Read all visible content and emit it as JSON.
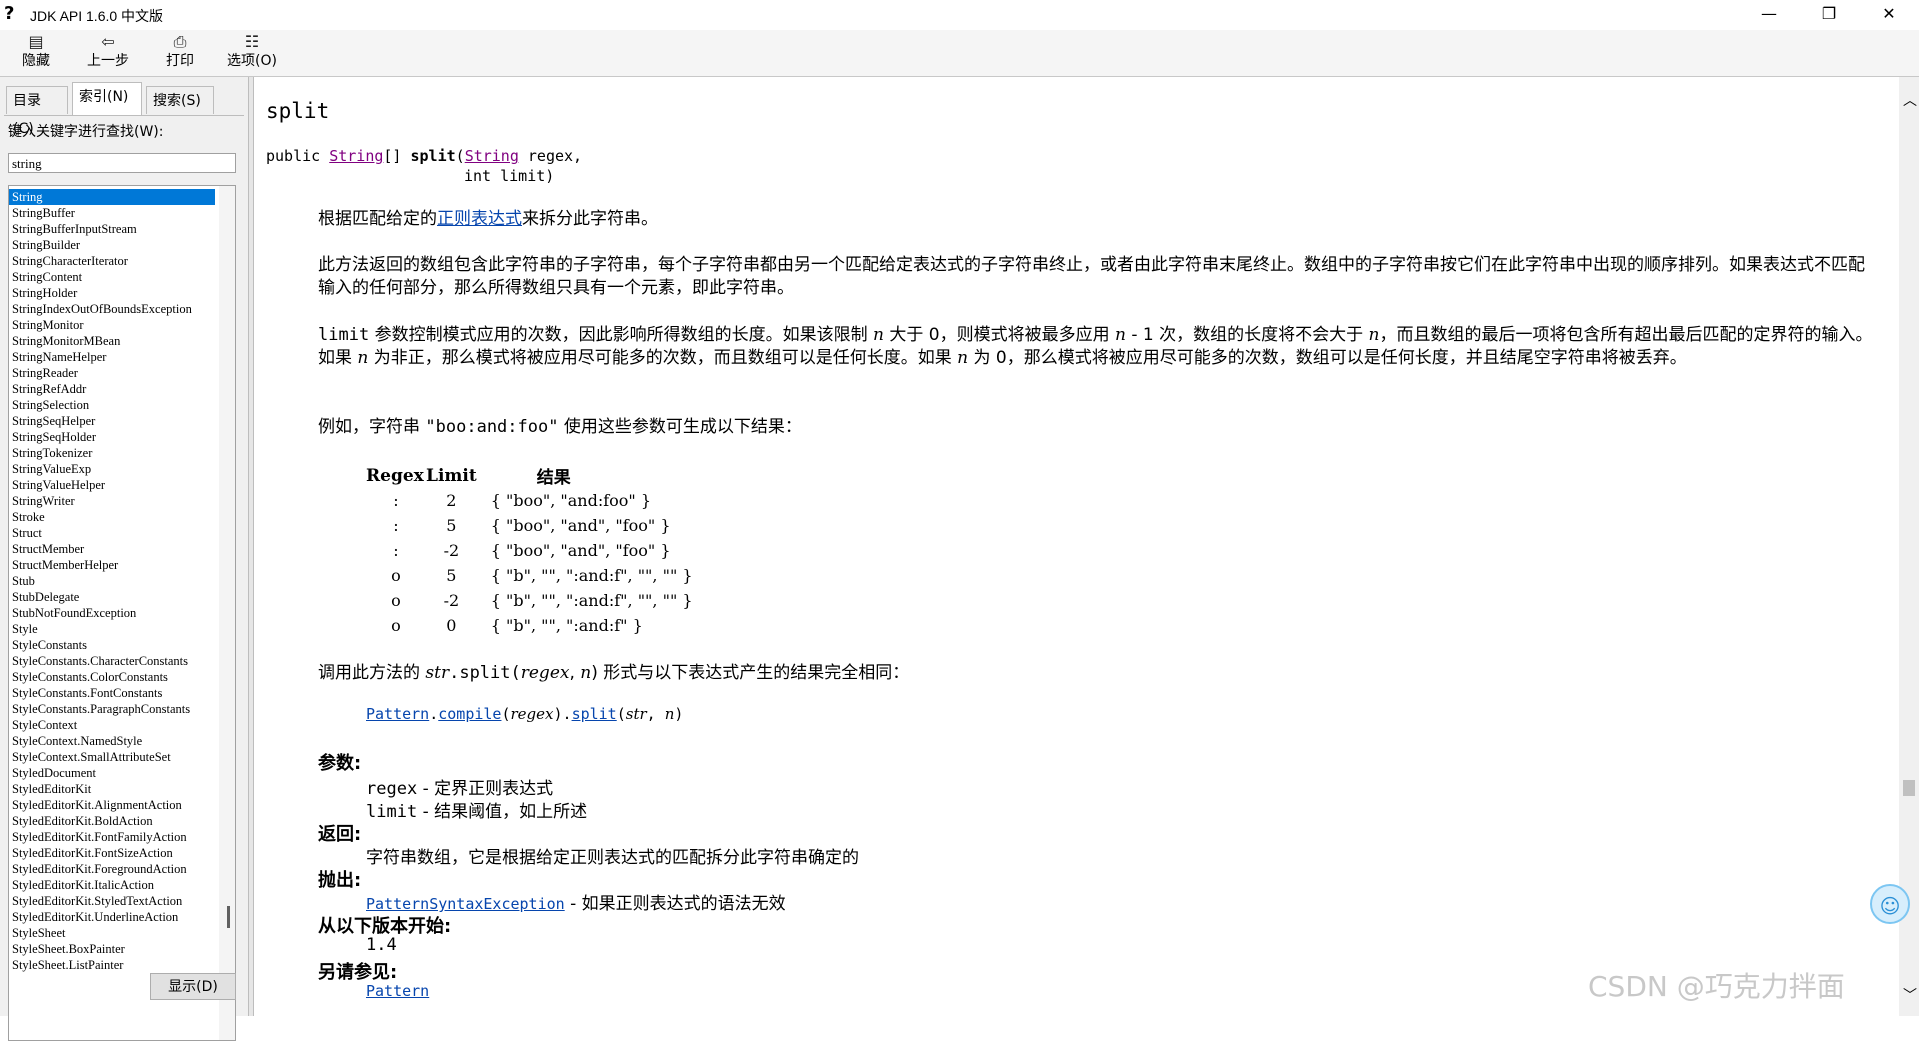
{
  "window": {
    "title": "JDK API 1.6.0 中文版",
    "icon": "help-question-icon",
    "controls": {
      "minimize": "—",
      "maximize": "❐",
      "close": "✕"
    }
  },
  "toolbar": {
    "hide": {
      "icon": "hide-pane-icon",
      "glyph": "▤",
      "label": "隐藏"
    },
    "back": {
      "icon": "back-arrow-icon",
      "glyph": "⇦",
      "label": "上一步"
    },
    "print": {
      "icon": "printer-icon",
      "glyph": "⎙",
      "label": "打印"
    },
    "options": {
      "icon": "options-icon",
      "glyph": "☷",
      "label": "选项(O)"
    }
  },
  "leftpanel": {
    "tabs": {
      "contents": "目录(C)",
      "index": "索引(N)",
      "search": "搜索(S)"
    },
    "keyword_label": "键入关键字进行查找(W):",
    "keyword_value": "string",
    "items": [
      "String",
      "StringBuffer",
      "StringBufferInputStream",
      "StringBuilder",
      "StringCharacterIterator",
      "StringContent",
      "StringHolder",
      "StringIndexOutOfBoundsException",
      "StringMonitor",
      "StringMonitorMBean",
      "StringNameHelper",
      "StringReader",
      "StringRefAddr",
      "StringSelection",
      "StringSeqHelper",
      "StringSeqHolder",
      "StringTokenizer",
      "StringValueExp",
      "StringValueHelper",
      "StringWriter",
      "Stroke",
      "Struct",
      "StructMember",
      "StructMemberHelper",
      "Stub",
      "StubDelegate",
      "StubNotFoundException",
      "Style",
      "StyleConstants",
      "StyleConstants.CharacterConstants",
      "StyleConstants.ColorConstants",
      "StyleConstants.FontConstants",
      "StyleConstants.ParagraphConstants",
      "StyleContext",
      "StyleContext.NamedStyle",
      "StyleContext.SmallAttributeSet",
      "StyledDocument",
      "StyledEditorKit",
      "StyledEditorKit.AlignmentAction",
      "StyledEditorKit.BoldAction",
      "StyledEditorKit.FontFamilyAction",
      "StyledEditorKit.FontSizeAction",
      "StyledEditorKit.ForegroundAction",
      "StyledEditorKit.ItalicAction",
      "StyledEditorKit.StyledTextAction",
      "StyledEditorKit.UnderlineAction",
      "StyleSheet",
      "StyleSheet.BoxPainter",
      "StyleSheet.ListPainter"
    ],
    "selected_index": 0,
    "display_button": "显示(D)"
  },
  "content": {
    "method_name": "split",
    "sig": {
      "public": "public ",
      "string_type": "String",
      "arr": "[] ",
      "name": "split",
      "open": "(",
      "param_type": "String",
      "param1": " regex,",
      "param2": "int limit)"
    },
    "p1": {
      "pre": "根据匹配给定的",
      "link": "正则表达式",
      "post": "来拆分此字符串。"
    },
    "p2": "此方法返回的数组包含此字符串的子字符串，每个子字符串都由另一个匹配给定表达式的子字符串终止，或者由此字符串末尾终止。数组中的子字符串按它们在此字符串中出现的顺序排列。如果表达式不匹配输入的任何部分，那么所得数组只具有一个元素，即此字符串。",
    "p3": {
      "code": "limit",
      "a": " 参数控制模式应用的次数，因此影响所得数组的长度。如果该限制 ",
      "n1": "n",
      "b": " 大于 0，则模式将被最多应用 ",
      "n2": "n",
      "c": " - 1 次，数组的长度将不会大于 ",
      "n3": "n",
      "d": "，而且数组的最后一项将包含所有超出最后匹配的定界符的输入。如果 ",
      "n4": "n",
      "e": " 为非正，那么模式将被应用尽可能多的次数，而且数组可以是任何长度。如果 ",
      "n5": "n",
      "f": " 为 0，那么模式将被应用尽可能多的次数，数组可以是任何长度，并且结尾空字符串将被丢弃。"
    },
    "p4": {
      "pre": "例如，字符串 ",
      "code": "\"boo:and:foo\"",
      "post": " 使用这些参数可生成以下结果："
    },
    "table": {
      "headers": [
        "Regex",
        "Limit",
        "结果"
      ],
      "rows": [
        [
          ":",
          "2",
          "{ \"boo\", \"and:foo\" }"
        ],
        [
          ":",
          "5",
          "{ \"boo\", \"and\", \"foo\" }"
        ],
        [
          ":",
          "-2",
          "{ \"boo\", \"and\", \"foo\" }"
        ],
        [
          "o",
          "5",
          "{ \"b\", \"\", \":and:f\", \"\", \"\" }"
        ],
        [
          "o",
          "-2",
          "{ \"b\", \"\", \":and:f\", \"\", \"\" }"
        ],
        [
          "o",
          "0",
          "{ \"b\", \"\", \":and:f\" }"
        ]
      ]
    },
    "p5": {
      "pre": "调用此方法的 ",
      "str": "str",
      "mid": ".split(",
      "regex": "regex",
      "comma": ", ",
      "n": "n",
      "post": ") 形式与以下表达式产生的结果完全相同："
    },
    "code": {
      "pattern": "Pattern",
      "dot1": ".",
      "compile": "compile",
      "open": "(",
      "regex": "regex",
      "close_dot": ").",
      "split": "split",
      "open2": "(",
      "str": "str",
      "comma": ", ",
      "n": "n",
      "close": ")"
    },
    "params_title": "参数:",
    "param1": {
      "code": "regex",
      "desc": " - 定界正则表达式"
    },
    "param2": {
      "code": "limit",
      "desc": " - 结果阈值，如上所述"
    },
    "returns_title": "返回:",
    "returns": "字符串数组，它是根据给定正则表达式的匹配拆分此字符串确定的",
    "throws_title": "抛出:",
    "throws": {
      "link": "PatternSyntaxException",
      "desc": " - 如果正则表达式的语法无效"
    },
    "since_title": "从以下版本开始:",
    "since": "1.4",
    "seealso_title": "另请参见:",
    "seealso": "Pattern"
  },
  "watermark": "CSDN @巧克力拌面",
  "scroll": {
    "up": "︿",
    "down": "﹀"
  },
  "assistant_icon": "chat-assistant-icon"
}
